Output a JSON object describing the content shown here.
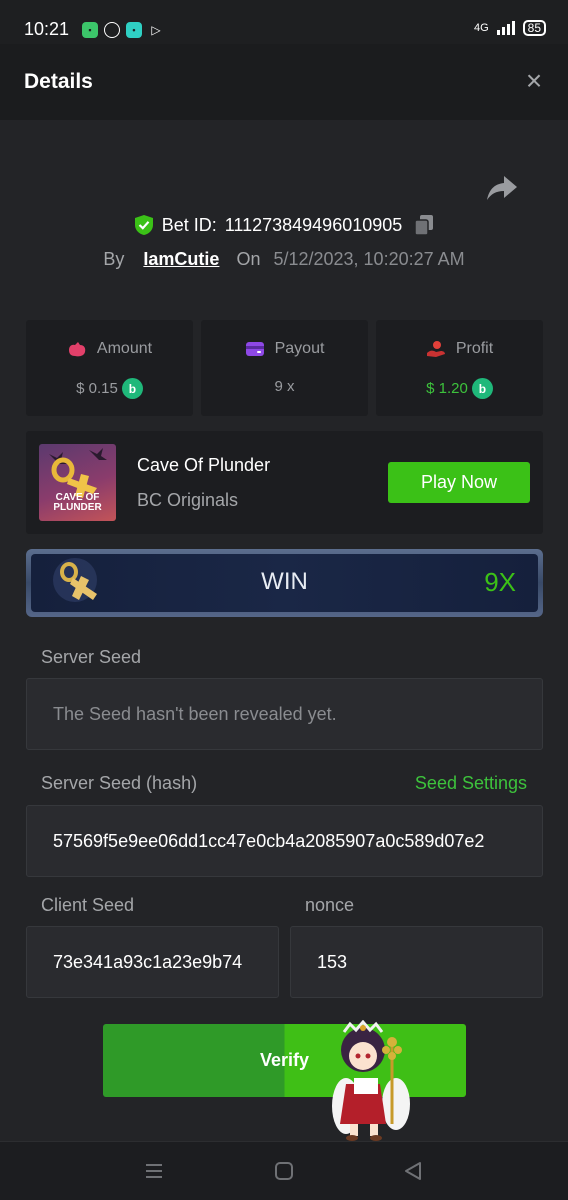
{
  "status_bar": {
    "time": "10:21",
    "network": "4G",
    "battery": "85"
  },
  "header": {
    "title": "Details",
    "close_symbol": "×"
  },
  "bet": {
    "bet_id_label": "Bet ID:",
    "bet_id": "111273849496010905",
    "by_label": "By",
    "username": "IamCutie",
    "on_label": "On",
    "datetime": "5/12/2023, 10:20:27 AM"
  },
  "stats": {
    "amount": {
      "label": "Amount",
      "value": "$ 0.15",
      "icon": "money-bag-icon"
    },
    "payout": {
      "label": "Payout",
      "value": "9 x",
      "icon": "wallet-icon"
    },
    "profit": {
      "label": "Profit",
      "value": "$ 1.20",
      "icon": "hand-coin-icon"
    },
    "coin_symbol": "b"
  },
  "game": {
    "name": "Cave Of Plunder",
    "provider": "BC Originals",
    "thumb_text_1": "CAVE OF",
    "thumb_text_2": "PLUNDER",
    "play_label": "Play Now"
  },
  "result": {
    "label": "WIN",
    "multiplier": "9X"
  },
  "seeds": {
    "server_seed_label": "Server Seed",
    "server_seed_value": "The Seed hasn't been revealed yet.",
    "server_hash_label": "Server Seed (hash)",
    "seed_settings_label": "Seed Settings",
    "server_hash_value": "57569f5e9ee06dd1cc47e0cb4a2085907a0c589d07e2",
    "client_seed_label": "Client Seed",
    "client_seed_value": "73e341a93c1a23e9b74",
    "nonce_label": "nonce",
    "nonce_value": "153"
  },
  "verify": {
    "label": "Verify"
  },
  "colors": {
    "accent_green": "#3bc117",
    "background": "#232427",
    "card": "#1c1d20"
  }
}
